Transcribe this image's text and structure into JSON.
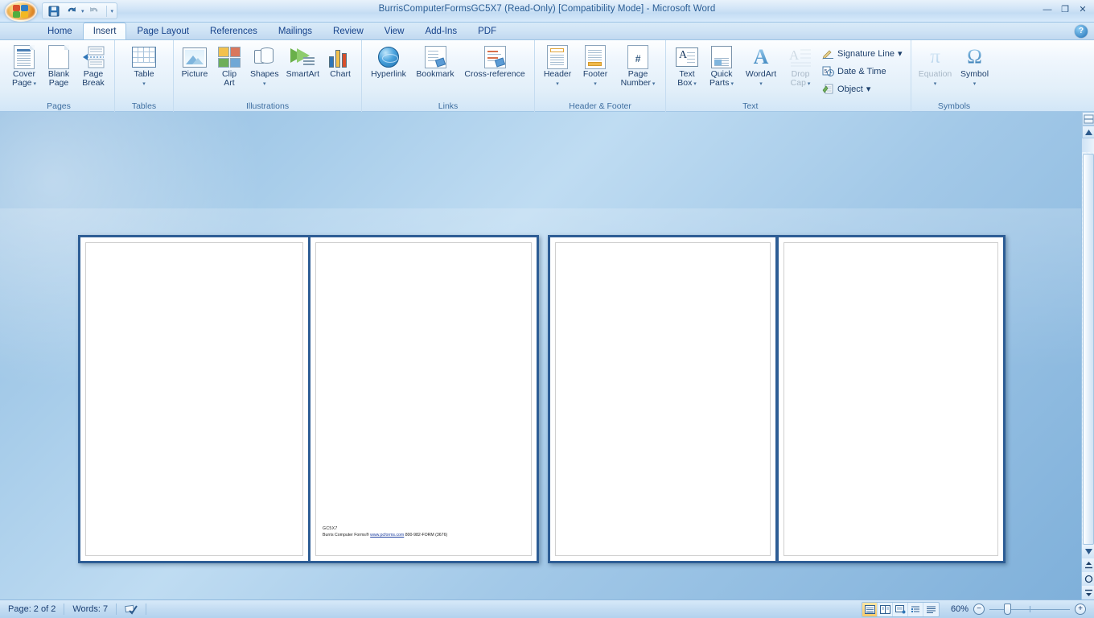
{
  "window": {
    "title": "BurrisComputerFormsGC5X7 (Read-Only) [Compatibility Mode] - Microsoft Word",
    "minimize_label": "—",
    "restore_label": "❐",
    "close_label": "✕",
    "help_label": "?"
  },
  "quick_access": {
    "office_button": "office-orb",
    "items": [
      {
        "name": "save",
        "icon": "save-icon",
        "label": "Save"
      },
      {
        "name": "undo",
        "icon": "undo-icon",
        "label": "Undo"
      },
      {
        "name": "redo",
        "icon": "redo-icon",
        "label": "Redo"
      }
    ],
    "customize_label": "▾"
  },
  "tabs": [
    {
      "label": "Home",
      "active": false
    },
    {
      "label": "Insert",
      "active": true
    },
    {
      "label": "Page Layout",
      "active": false
    },
    {
      "label": "References",
      "active": false
    },
    {
      "label": "Mailings",
      "active": false
    },
    {
      "label": "Review",
      "active": false
    },
    {
      "label": "View",
      "active": false
    },
    {
      "label": "Add-Ins",
      "active": false
    },
    {
      "label": "PDF",
      "active": false
    }
  ],
  "ribbon": {
    "groups": [
      {
        "label": "Pages",
        "buttons": [
          {
            "line1": "Cover",
            "line2": "Page",
            "caret": true,
            "disabled": false
          },
          {
            "line1": "Blank",
            "line2": "Page",
            "caret": false,
            "disabled": false
          },
          {
            "line1": "Page",
            "line2": "Break",
            "caret": false,
            "disabled": false
          }
        ]
      },
      {
        "label": "Tables",
        "buttons": [
          {
            "line1": "Table",
            "line2": "",
            "caret": true,
            "disabled": false
          }
        ]
      },
      {
        "label": "Illustrations",
        "buttons": [
          {
            "line1": "Picture",
            "line2": "",
            "caret": false,
            "disabled": false
          },
          {
            "line1": "Clip",
            "line2": "Art",
            "caret": false,
            "disabled": false
          },
          {
            "line1": "Shapes",
            "line2": "",
            "caret": true,
            "disabled": false
          },
          {
            "line1": "SmartArt",
            "line2": "",
            "caret": false,
            "disabled": false
          },
          {
            "line1": "Chart",
            "line2": "",
            "caret": false,
            "disabled": false
          }
        ]
      },
      {
        "label": "Links",
        "buttons": [
          {
            "line1": "Hyperlink",
            "line2": "",
            "caret": false,
            "disabled": false
          },
          {
            "line1": "Bookmark",
            "line2": "",
            "caret": false,
            "disabled": false
          },
          {
            "line1": "Cross-reference",
            "line2": "",
            "caret": false,
            "disabled": false
          }
        ]
      },
      {
        "label": "Header & Footer",
        "buttons": [
          {
            "line1": "Header",
            "line2": "",
            "caret": true,
            "disabled": false
          },
          {
            "line1": "Footer",
            "line2": "",
            "caret": true,
            "disabled": false
          },
          {
            "line1": "Page",
            "line2": "Number",
            "caret": true,
            "disabled": false
          }
        ]
      },
      {
        "label": "Text",
        "buttons": [
          {
            "line1": "Text",
            "line2": "Box",
            "caret": true,
            "disabled": false
          },
          {
            "line1": "Quick",
            "line2": "Parts",
            "caret": true,
            "disabled": false
          },
          {
            "line1": "WordArt",
            "line2": "",
            "caret": true,
            "disabled": false
          },
          {
            "line1": "Drop",
            "line2": "Cap",
            "caret": true,
            "disabled": true
          }
        ],
        "small_buttons": [
          {
            "label": "Signature Line",
            "caret": true,
            "icon": "signature-icon"
          },
          {
            "label": "Date & Time",
            "caret": false,
            "icon": "date-time-icon"
          },
          {
            "label": "Object",
            "caret": true,
            "icon": "object-icon"
          }
        ]
      },
      {
        "label": "Symbols",
        "buttons": [
          {
            "line1": "Equation",
            "line2": "",
            "caret": true,
            "disabled": true
          },
          {
            "line1": "Symbol",
            "line2": "",
            "caret": true,
            "disabled": false
          }
        ]
      }
    ]
  },
  "document": {
    "footer_code": "GC5X7",
    "footer_line": "Burris Computer Forms®  ",
    "footer_link": "www.pcforms.com",
    "footer_tail": "  800-982-FORM (3676)",
    "pages": [
      {
        "id": "page-1",
        "has_text": false
      },
      {
        "id": "page-2",
        "has_text": true
      },
      {
        "id": "page-3",
        "has_text": false
      },
      {
        "id": "page-4",
        "has_text": false
      }
    ]
  },
  "scrollbar": {
    "up_label": "▲",
    "down_label": "▼",
    "prev_page_label": "⨏",
    "browse_object_label": "○",
    "next_page_label": "⨏"
  },
  "status_bar": {
    "page_info": "Page: 2 of 2",
    "word_count": "Words: 7",
    "proofing_icon": "spell-check-icon",
    "zoom_level": "60%",
    "zoom_out_label": "−",
    "zoom_in_label": "+",
    "views": [
      {
        "name": "print-layout",
        "active": true
      },
      {
        "name": "full-screen-reading",
        "active": false
      },
      {
        "name": "web-layout",
        "active": false
      },
      {
        "name": "outline",
        "active": false
      },
      {
        "name": "draft",
        "active": false
      }
    ]
  },
  "colors": {
    "accent": "#15428b",
    "ribbon_bg": "#e2eff9",
    "workspace_bg": "#a8cdea",
    "page_border": "#2d5d95",
    "link": "#1d3fa0"
  }
}
